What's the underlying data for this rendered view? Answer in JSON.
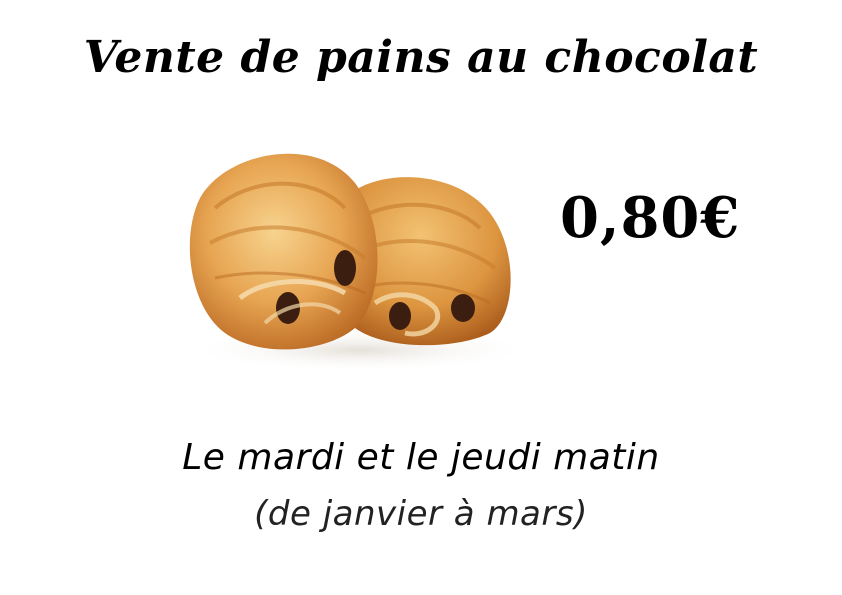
{
  "poster": {
    "title": "Vente de pains au chocolat",
    "price": "0,80€",
    "schedule": "Le mardi et le jeudi matin",
    "period": "(de janvier à mars)"
  },
  "image": {
    "subject": "pains-au-chocolat-photo",
    "colors": {
      "pastry_light": "#f3c47a",
      "pastry_mid": "#e29a45",
      "pastry_dark": "#b8621d",
      "chocolate": "#3b1e10"
    }
  }
}
